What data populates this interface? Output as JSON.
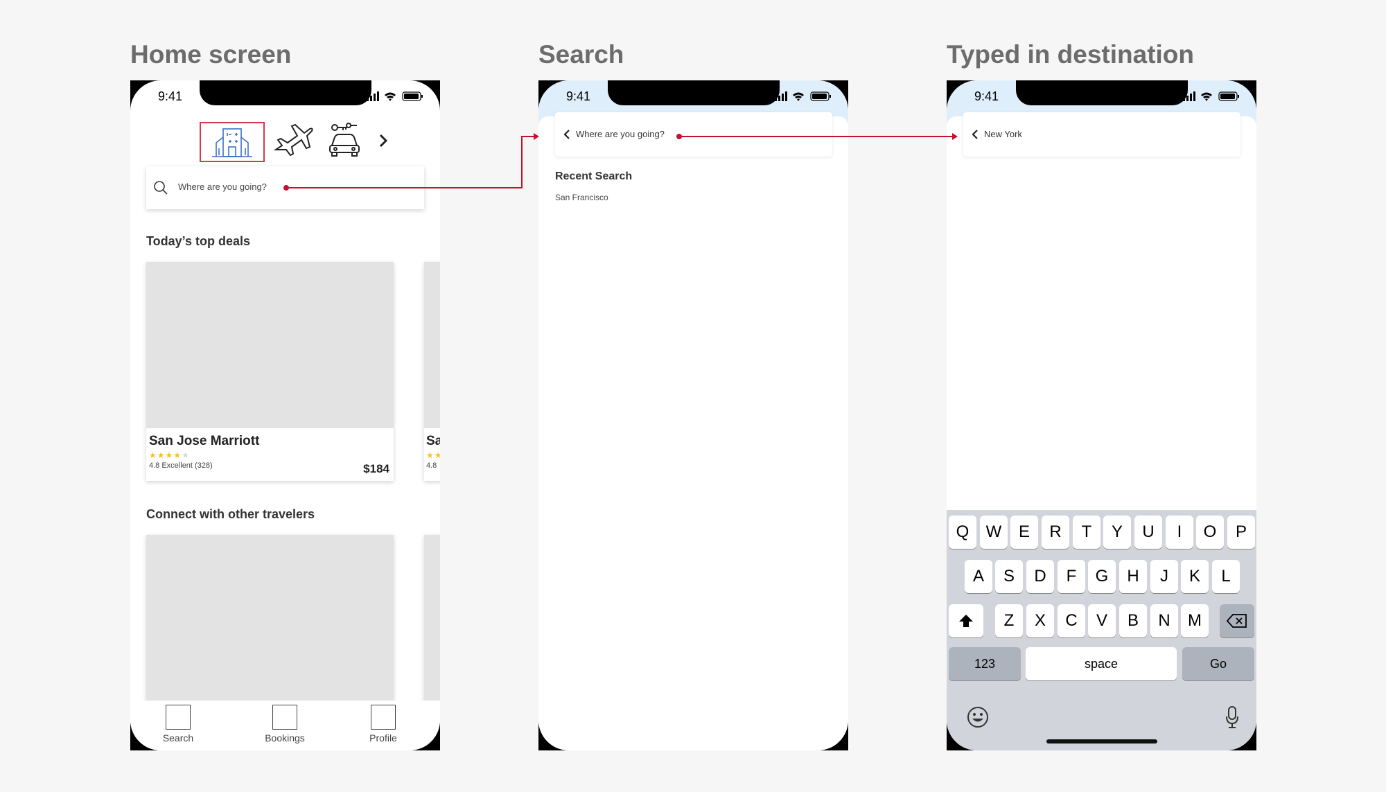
{
  "titles": {
    "home": "Home screen",
    "search": "Search",
    "typed": "Typed in destination"
  },
  "status": {
    "time": "9:41"
  },
  "home": {
    "search_placeholder": "Where are you going?",
    "categories": [
      "hotel-icon",
      "plane-icon",
      "car-rental-icon",
      "chevron-right-icon"
    ],
    "deals_heading": "Today’s top deals",
    "deal": {
      "name": "San Jose Marriott",
      "stars_filled": 4,
      "stars_total": 5,
      "rating_text": "4.8 Excellent (328)",
      "price": "$184"
    },
    "peek_name": "Sa",
    "peek_rating": "4.8",
    "connect_heading": "Connect with other travelers",
    "tabs": [
      "Search",
      "Bookings",
      "Profile"
    ]
  },
  "search": {
    "placeholder": "Where are you going?",
    "recent_heading": "Recent Search",
    "recent_items": [
      "San Francisco"
    ]
  },
  "typed": {
    "value": "New York",
    "keyboard": {
      "row1": [
        "Q",
        "W",
        "E",
        "R",
        "T",
        "Y",
        "U",
        "I",
        "O",
        "P"
      ],
      "row2": [
        "A",
        "S",
        "D",
        "F",
        "G",
        "H",
        "J",
        "K",
        "L"
      ],
      "row3": [
        "Z",
        "X",
        "C",
        "V",
        "B",
        "N",
        "M"
      ],
      "numbers": "123",
      "space": "space",
      "go": "Go"
    }
  },
  "colors": {
    "accent_red": "#c8102e",
    "selected_border": "#d63a4a",
    "star_yellow": "#f3c21c",
    "header_blue": "#dfeefb"
  }
}
